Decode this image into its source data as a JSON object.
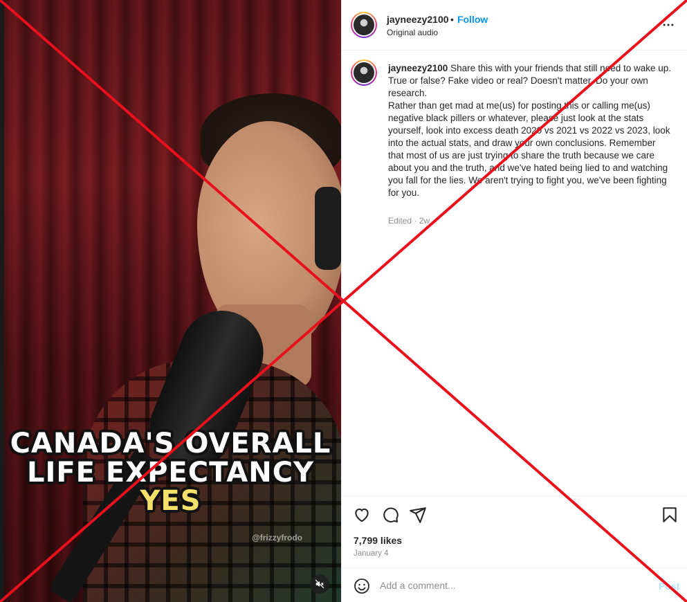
{
  "media": {
    "caption_line1": "CANADA'S OVERALL",
    "caption_line2": "LIFE EXPECTANCY",
    "caption_line3": "YES",
    "watermark": "@frizzyfrodo",
    "mute_icon": "speaker-muted-icon"
  },
  "header": {
    "username": "jayneezy2100",
    "separator": "•",
    "follow_label": "Follow",
    "audio_label": "Original audio",
    "more_icon": "more-horizontal-icon"
  },
  "post": {
    "username": "jayneezy2100",
    "paragraphs": [
      "Share this with your friends that still need to wake up.",
      "True or false? Fake video or real? Doesn't matter. Do your own research.",
      "Rather than get mad at me(us) for posting this or calling me(us) negative black pillers or whatever, please just look at the stats yourself, look into excess death 2020 vs 2021 vs 2022 vs 2023, look into the actual stats, and draw your own conclusions. Remember that most of us are just trying to share the truth because we care about you and the truth, and we've hated being lied to and watching you fall for the lies. We aren't trying to fight you, we've been fighting for you."
    ],
    "meta": "Edited · 2w"
  },
  "actions": {
    "icons": [
      "heart-icon",
      "comment-icon",
      "share-icon",
      "bookmark-icon"
    ],
    "likes": "7,799 likes",
    "date": "January 4"
  },
  "add_comment": {
    "placeholder": "Add a comment...",
    "post_label": "Post",
    "emoji_icon": "emoji-icon"
  },
  "colors": {
    "link": "#0095f6",
    "text": "#262626",
    "muted": "#8e8e8e",
    "overlay_x": "#e8101c",
    "caption_highlight": "#f4e06a"
  }
}
